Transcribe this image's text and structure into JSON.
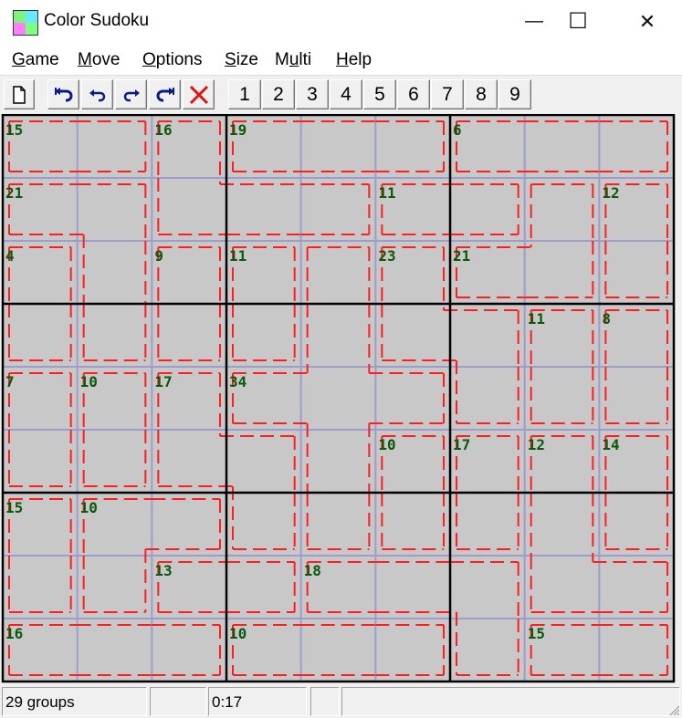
{
  "window": {
    "title": "Color Sudoku",
    "minimize": "—",
    "maximize": "☐",
    "close": "✕"
  },
  "menu": [
    {
      "accel": "G",
      "rest": "ame"
    },
    {
      "accel": "M",
      "rest": "ove"
    },
    {
      "accel": "O",
      "rest": "ptions"
    },
    {
      "accel": "S",
      "rest": "ize"
    },
    {
      "pre": "M",
      "accel": "u",
      "rest": "lti"
    },
    {
      "accel": "H",
      "rest": "elp"
    }
  ],
  "toolbar": {
    "icons": [
      "new-document-icon",
      "undo-all-icon",
      "undo-icon",
      "redo-icon",
      "redo-all-icon",
      "clear-icon"
    ],
    "numbers": [
      "1",
      "2",
      "3",
      "4",
      "5",
      "6",
      "7",
      "8",
      "9"
    ]
  },
  "colors": {
    "cell": "#c8c8c8",
    "thin_line": "#9d9dcc",
    "thick_line": "#000000",
    "cage": "#ff1e1e",
    "label": "#0b5a0b"
  },
  "board": {
    "cage_map": [
      [
        "A",
        "A",
        "B",
        "C",
        "C",
        "C",
        "D",
        "D",
        "D"
      ],
      [
        "E",
        "E",
        "B",
        "B",
        "B",
        "F",
        "F",
        "G",
        "H"
      ],
      [
        "I",
        "E",
        "J",
        "K",
        "L",
        "M",
        "G",
        "G",
        "H"
      ],
      [
        "I",
        "E",
        "J",
        "K",
        "L",
        "M",
        "M",
        "N",
        "O"
      ],
      [
        "P",
        "Q",
        "R",
        "L",
        "L",
        "L",
        "M",
        "N",
        "O"
      ],
      [
        "P",
        "Q",
        "R",
        "R",
        "L",
        "S",
        "T",
        "U",
        "V"
      ],
      [
        "W",
        "X",
        "X",
        "R",
        "L",
        "S",
        "T",
        "U",
        "V"
      ],
      [
        "W",
        "X",
        "Y",
        "Y",
        "Z",
        "Z",
        "Z",
        "U",
        "U"
      ],
      [
        "AA",
        "AA",
        "AA",
        "AB",
        "AB",
        "AB",
        "Z",
        "AC",
        "AC"
      ]
    ],
    "cages": [
      {
        "id": "A",
        "sum": "15",
        "cell": [
          0,
          0
        ]
      },
      {
        "id": "B",
        "sum": "16",
        "cell": [
          0,
          2
        ]
      },
      {
        "id": "C",
        "sum": "19",
        "cell": [
          0,
          3
        ]
      },
      {
        "id": "D",
        "sum": "6",
        "cell": [
          0,
          6
        ]
      },
      {
        "id": "E",
        "sum": "21",
        "cell": [
          1,
          0
        ]
      },
      {
        "id": "F",
        "sum": "11",
        "cell": [
          1,
          5
        ]
      },
      {
        "id": "G",
        "sum": "21",
        "cell": [
          2,
          6
        ]
      },
      {
        "id": "H",
        "sum": "12",
        "cell": [
          1,
          8
        ]
      },
      {
        "id": "I",
        "sum": "4",
        "cell": [
          2,
          0
        ]
      },
      {
        "id": "J",
        "sum": "9",
        "cell": [
          2,
          2
        ]
      },
      {
        "id": "K",
        "sum": "11",
        "cell": [
          2,
          3
        ]
      },
      {
        "id": "L",
        "sum": "34",
        "cell": [
          4,
          3
        ]
      },
      {
        "id": "M",
        "sum": "23",
        "cell": [
          2,
          5
        ]
      },
      {
        "id": "N",
        "sum": "11",
        "cell": [
          3,
          7
        ]
      },
      {
        "id": "O",
        "sum": "8",
        "cell": [
          3,
          8
        ]
      },
      {
        "id": "P",
        "sum": "7",
        "cell": [
          4,
          0
        ]
      },
      {
        "id": "Q",
        "sum": "10",
        "cell": [
          4,
          1
        ]
      },
      {
        "id": "R",
        "sum": "17",
        "cell": [
          4,
          2
        ]
      },
      {
        "id": "S",
        "sum": "10",
        "cell": [
          5,
          5
        ]
      },
      {
        "id": "T",
        "sum": "17",
        "cell": [
          5,
          6
        ]
      },
      {
        "id": "U",
        "sum": "12",
        "cell": [
          5,
          7
        ]
      },
      {
        "id": "V",
        "sum": "14",
        "cell": [
          5,
          8
        ]
      },
      {
        "id": "W",
        "sum": "15",
        "cell": [
          6,
          0
        ]
      },
      {
        "id": "X",
        "sum": "10",
        "cell": [
          6,
          1
        ]
      },
      {
        "id": "Y",
        "sum": "13",
        "cell": [
          7,
          2
        ]
      },
      {
        "id": "Z",
        "sum": "18",
        "cell": [
          7,
          4
        ]
      },
      {
        "id": "AA",
        "sum": "16",
        "cell": [
          8,
          0
        ]
      },
      {
        "id": "AB",
        "sum": "10",
        "cell": [
          8,
          3
        ]
      },
      {
        "id": "AC",
        "sum": "15",
        "cell": [
          8,
          7
        ]
      }
    ]
  },
  "status": {
    "groups": "29 groups",
    "pane2": "",
    "time": "0:17",
    "pane4": "",
    "pane5": ""
  }
}
